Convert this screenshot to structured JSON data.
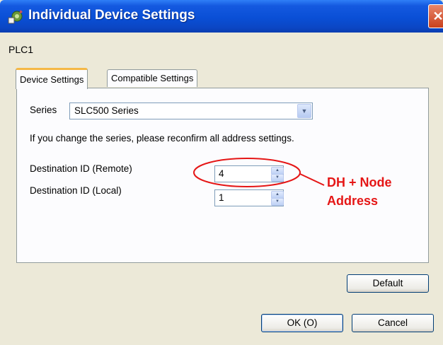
{
  "window": {
    "title": "Individual Device Settings",
    "close_glyph": "✕"
  },
  "device_name": "PLC1",
  "tabs": [
    {
      "label": "Device Settings",
      "active": true
    },
    {
      "label": "Compatible Settings",
      "active": false
    }
  ],
  "series": {
    "label": "Series",
    "value": "SLC500 Series"
  },
  "notice": "If you change the series, please reconfirm all address settings.",
  "destination_remote": {
    "label": "Destination ID (Remote)",
    "value": "4"
  },
  "destination_local": {
    "label": "Destination ID (Local)",
    "value": "1"
  },
  "annotation": {
    "line1": "DH + Node",
    "line2": "Address",
    "color": "#e51616"
  },
  "buttons": {
    "default": "Default",
    "ok": "OK (O)",
    "cancel": "Cancel"
  },
  "icons": {
    "app": "device-settings-icon",
    "dropdown": "chevron-down-icon",
    "spin_up": "chevron-up-icon",
    "spin_down": "chevron-down-icon",
    "close": "close-icon"
  }
}
